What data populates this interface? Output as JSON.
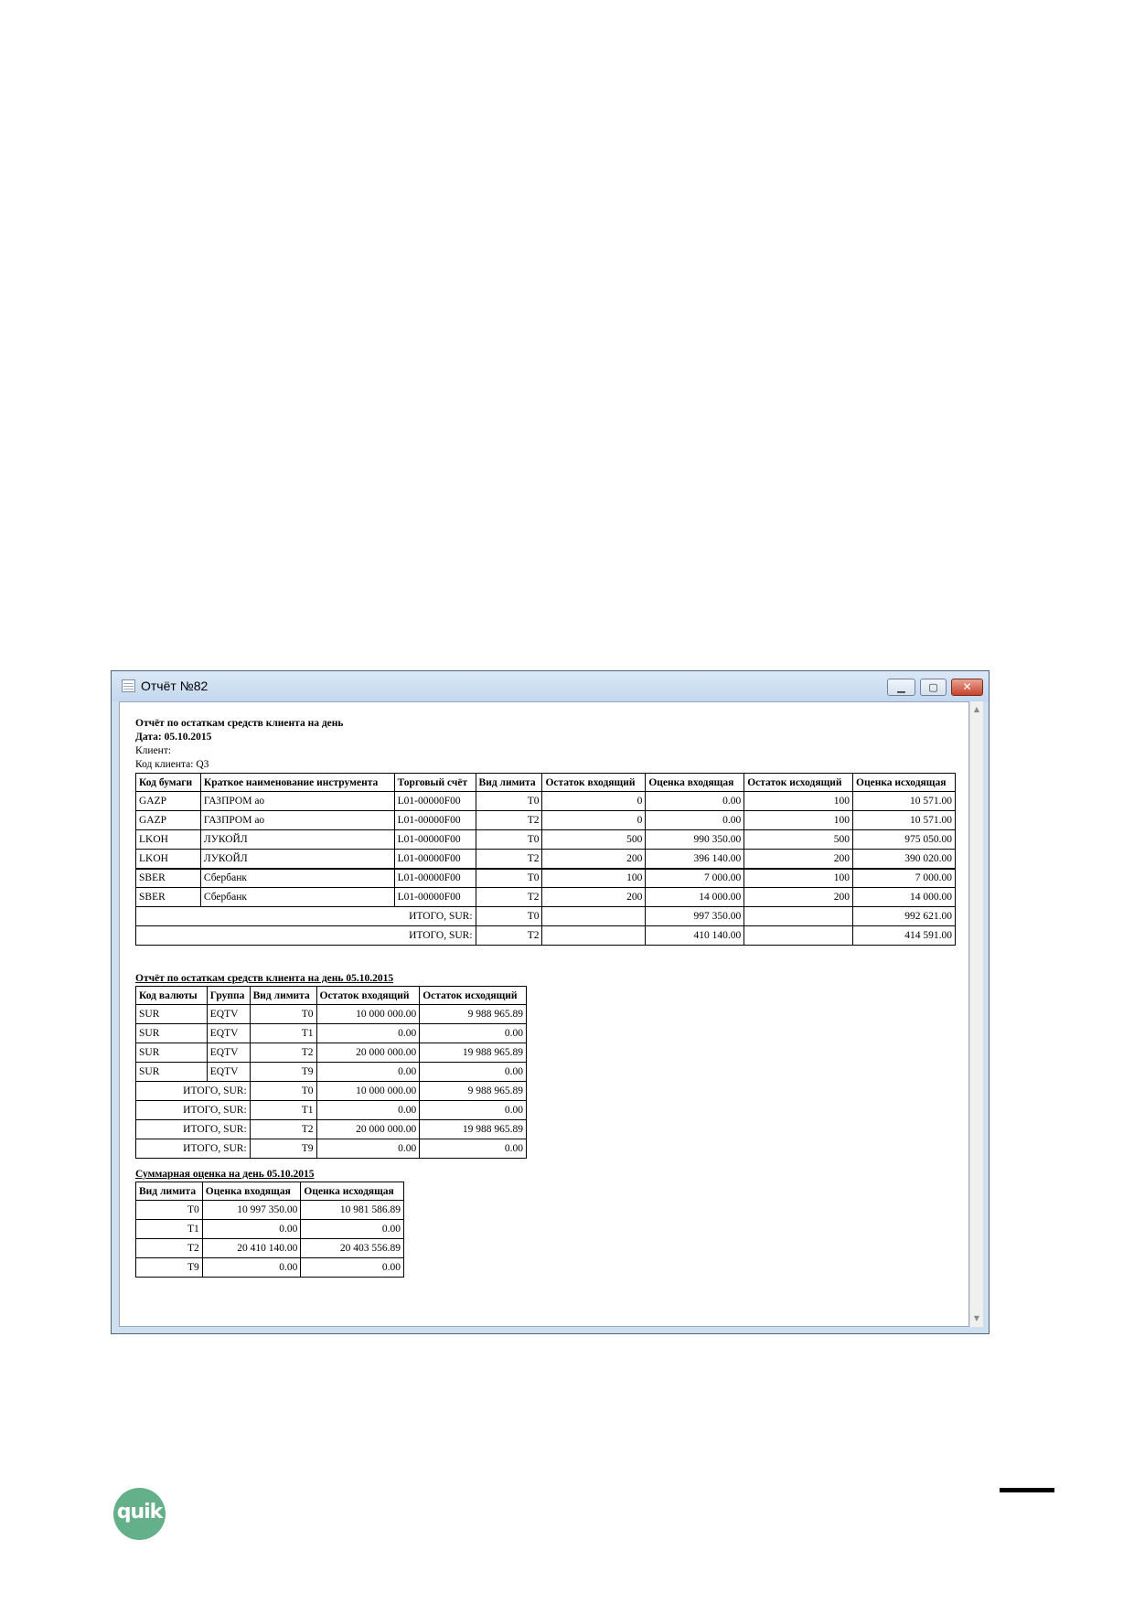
{
  "window": {
    "title": "Отчёт №82",
    "buttons": {
      "minimize": "▁",
      "maximize": "▢",
      "close": "✕"
    },
    "scrollbar": {
      "up": "▲",
      "down": "▼"
    }
  },
  "report1": {
    "title": "Отчёт по остаткам средств клиента на день",
    "date": "Дата: 05.10.2015",
    "client": "Клиент:",
    "client_code": "Код клиента: Q3",
    "columns": [
      "Код бумаги",
      "Краткое наименование инструмента",
      "Торговый счёт",
      "Вид лимита",
      "Остаток входящий",
      "Оценка входящая",
      "Остаток исходящий",
      "Оценка исходящая"
    ],
    "rows": [
      [
        "GAZP",
        "ГАЗПРОМ ао",
        "L01-00000F00",
        "T0",
        "0",
        "0.00",
        "100",
        "10 571.00"
      ],
      [
        "GAZP",
        "ГАЗПРОМ ао",
        "L01-00000F00",
        "T2",
        "0",
        "0.00",
        "100",
        "10 571.00"
      ],
      [
        "LKOH",
        "ЛУКОЙЛ",
        "L01-00000F00",
        "T0",
        "500",
        "990 350.00",
        "500",
        "975 050.00"
      ],
      [
        "LKOH",
        "ЛУКОЙЛ",
        "L01-00000F00",
        "T2",
        "200",
        "396 140.00",
        "200",
        "390 020.00"
      ],
      [
        "SBER",
        "Сбербанк",
        "L01-00000F00",
        "T0",
        "100",
        "7 000.00",
        "100",
        "7 000.00"
      ],
      [
        "SBER",
        "Сбербанк",
        "L01-00000F00",
        "T2",
        "200",
        "14 000.00",
        "200",
        "14 000.00"
      ]
    ],
    "totals": [
      [
        "ИТОГО, SUR:",
        "T0",
        "",
        "997 350.00",
        "",
        "992 621.00"
      ],
      [
        "ИТОГО, SUR:",
        "T2",
        "",
        "410 140.00",
        "",
        "414 591.00"
      ]
    ]
  },
  "report2": {
    "title": "Отчёт по остаткам средств клиента на день 05.10.2015",
    "columns": [
      "Код валюты",
      "Группа",
      "Вид лимита",
      "Остаток входящий",
      "Остаток исходящий"
    ],
    "rows": [
      [
        "SUR",
        "EQTV",
        "T0",
        "10 000 000.00",
        "9 988 965.89"
      ],
      [
        "SUR",
        "EQTV",
        "T1",
        "0.00",
        "0.00"
      ],
      [
        "SUR",
        "EQTV",
        "T2",
        "20 000 000.00",
        "19 988 965.89"
      ],
      [
        "SUR",
        "EQTV",
        "T9",
        "0.00",
        "0.00"
      ]
    ],
    "totals": [
      [
        "ИТОГО, SUR:",
        "T0",
        "10 000 000.00",
        "9 988 965.89"
      ],
      [
        "ИТОГО, SUR:",
        "T1",
        "0.00",
        "0.00"
      ],
      [
        "ИТОГО, SUR:",
        "T2",
        "20 000 000.00",
        "19 988 965.89"
      ],
      [
        "ИТОГО, SUR:",
        "T9",
        "0.00",
        "0.00"
      ]
    ]
  },
  "report3": {
    "title": "Суммарная оценка на день 05.10.2015",
    "columns": [
      "Вид лимита",
      "Оценка входящая",
      "Оценка исходящая"
    ],
    "rows": [
      [
        "T0",
        "10 997 350.00",
        "10 981 586.89"
      ],
      [
        "T1",
        "0.00",
        "0.00"
      ],
      [
        "T2",
        "20 410 140.00",
        "20 403 556.89"
      ],
      [
        "T9",
        "0.00",
        "0.00"
      ]
    ]
  },
  "footer": {
    "logo_text": "quik",
    "brand_color": "#63b08a"
  }
}
